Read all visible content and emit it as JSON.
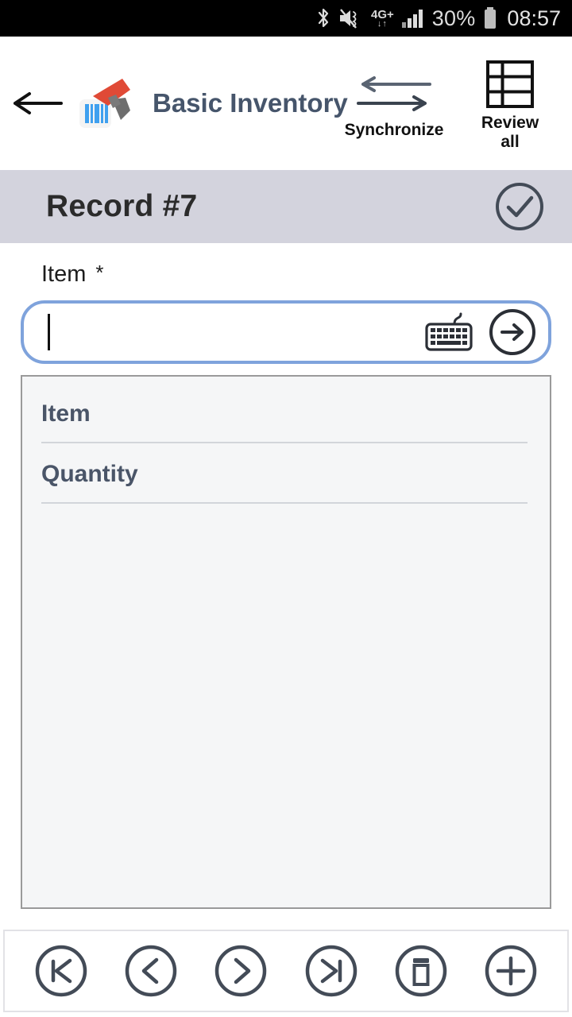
{
  "status_bar": {
    "bluetooth_icon": "bluetooth-icon",
    "mute_icon": "volume-mute-icon",
    "network_label": "4G+",
    "network_arrows": "↓↑",
    "signal_icon": "signal-bars-icon",
    "battery_percent": "30%",
    "battery_icon": "battery-icon",
    "time": "08:57"
  },
  "app_bar": {
    "back_icon": "arrow-left-icon",
    "logo_icon": "barcode-scanner-icon",
    "title": "Basic Inventory",
    "actions": [
      {
        "label": "Synchronize",
        "icon": "sync-arrows-icon"
      },
      {
        "label": "Review\nall",
        "label_line1": "Review",
        "label_line2": "all",
        "icon": "table-grid-icon"
      }
    ]
  },
  "record_bar": {
    "title": "Record #7",
    "confirm_icon": "check-circle-icon"
  },
  "form": {
    "scan_field": {
      "label": "Item",
      "required_marker": "*",
      "value": "",
      "placeholder": "",
      "keyboard_icon": "keyboard-icon",
      "submit_icon": "arrow-right-circle-icon"
    },
    "fields": [
      {
        "label": "Item",
        "value": ""
      },
      {
        "label": "Quantity",
        "value": ""
      }
    ]
  },
  "bottom_bar": {
    "buttons": [
      {
        "name": "first-record-button",
        "icon": "skip-to-start-icon"
      },
      {
        "name": "previous-record-button",
        "icon": "chevron-left-icon"
      },
      {
        "name": "next-record-button",
        "icon": "chevron-right-icon"
      },
      {
        "name": "last-record-button",
        "icon": "skip-to-end-icon"
      },
      {
        "name": "delete-record-button",
        "icon": "trash-icon"
      },
      {
        "name": "add-record-button",
        "icon": "plus-icon"
      }
    ]
  },
  "colors": {
    "accent_blue": "#7fa3dc",
    "header_lavender": "#d3d3dd",
    "slate": "#4a5568",
    "title_blue": "#46556b",
    "scanner_red": "#e04a36",
    "barcode_blue": "#3fa0ef"
  }
}
